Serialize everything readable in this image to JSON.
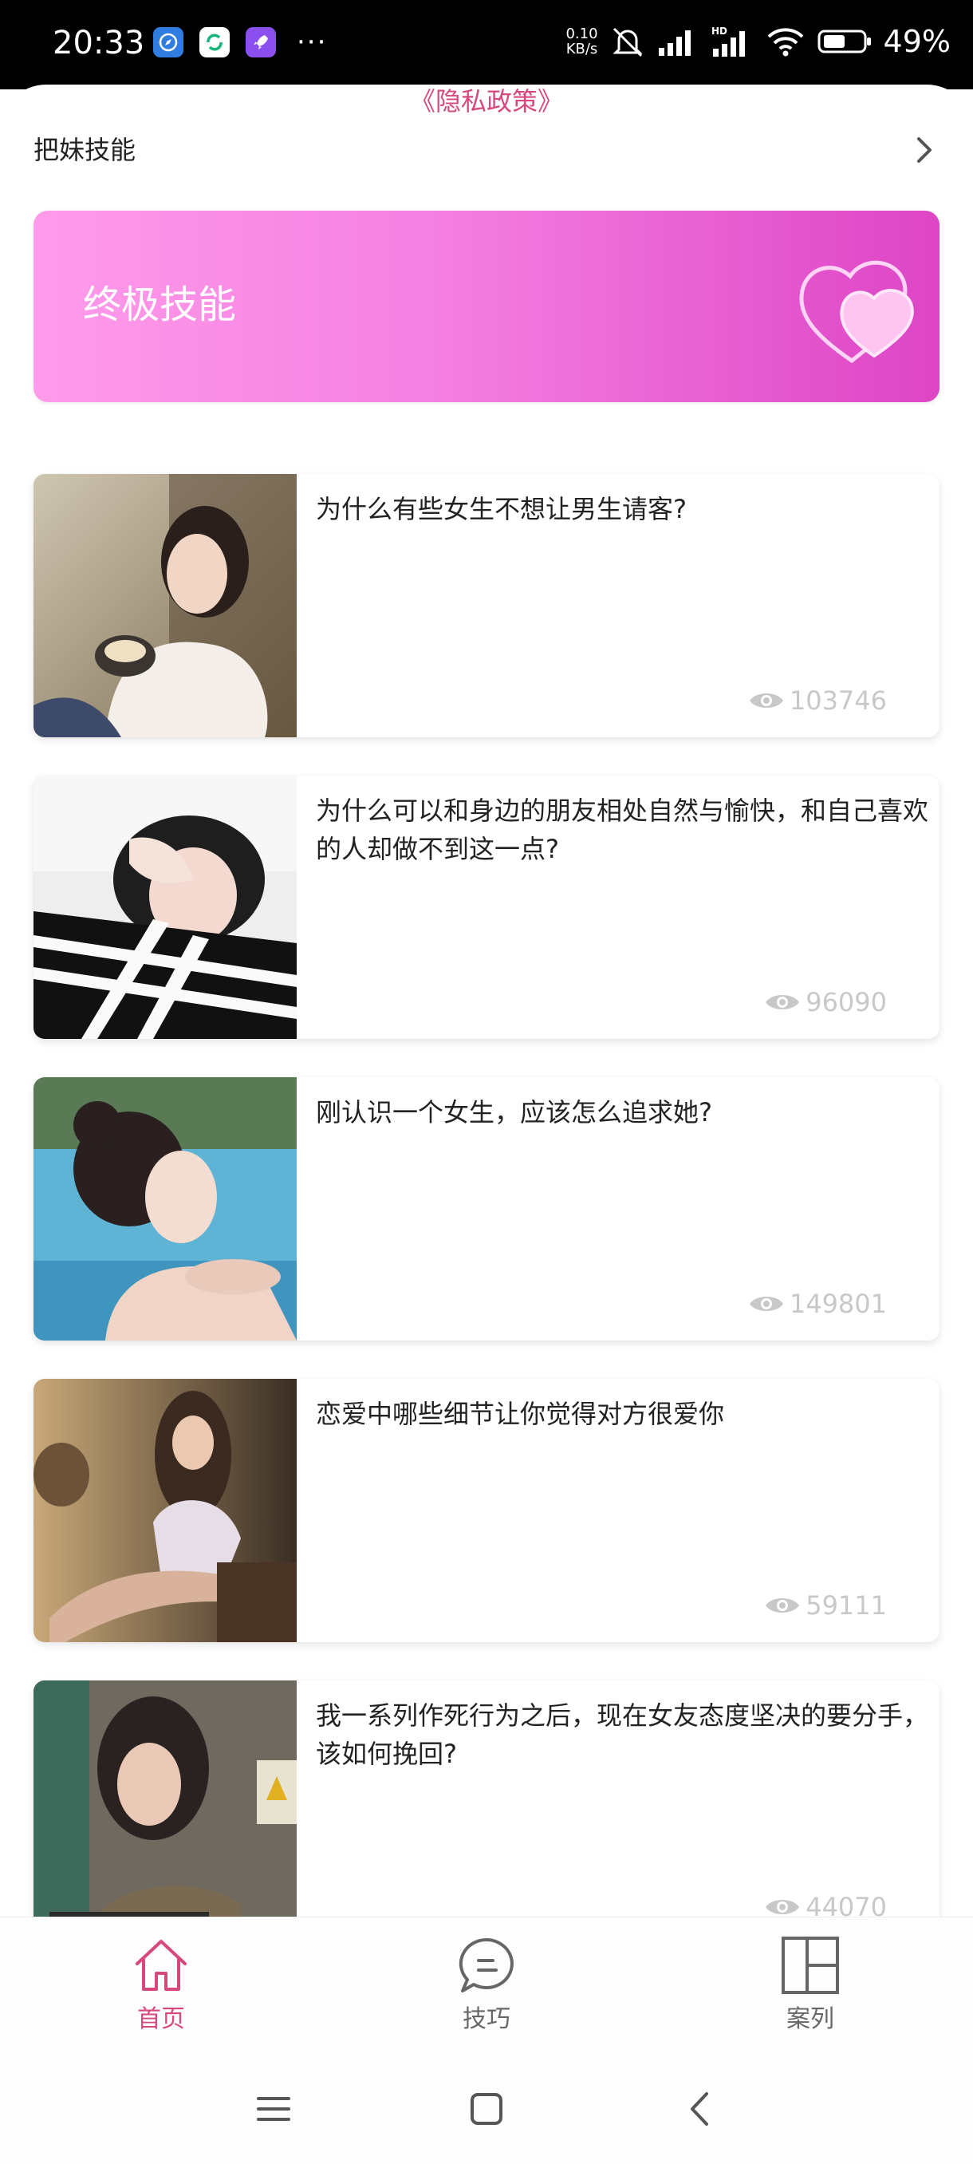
{
  "status_bar": {
    "time": "20:33",
    "net_speed_value": "0.10",
    "net_speed_unit": "KB/s",
    "battery": "49%",
    "more": "···"
  },
  "privacy_link": "《隐私政策》",
  "header": {
    "title": "把妹技能"
  },
  "banner": {
    "title": "终极技能"
  },
  "articles": [
    {
      "title": "为什么有些女生不想让男生请客?",
      "views": "103746"
    },
    {
      "title": "为什么可以和身边的朋友相处自然与愉快，和自己喜欢的人却做不到这一点?",
      "views": "96090"
    },
    {
      "title": "刚认识一个女生，应该怎么追求她?",
      "views": "149801"
    },
    {
      "title": "恋爱中哪些细节让你觉得对方很爱你",
      "views": "59111"
    },
    {
      "title": "我一系列作死行为之后，现在女友态度坚决的要分手，该如何挽回?",
      "views": "44070"
    }
  ],
  "bottom_nav": [
    {
      "label": "首页",
      "icon": "home-icon",
      "active": true
    },
    {
      "label": "技巧",
      "icon": "chat-bubble-icon",
      "active": false
    },
    {
      "label": "案列",
      "icon": "layout-grid-icon",
      "active": false
    }
  ],
  "colors": {
    "accent": "#d7487f",
    "banner_start": "#ff9bea",
    "banner_end": "#dd45c5",
    "muted": "#c8c8c8"
  }
}
